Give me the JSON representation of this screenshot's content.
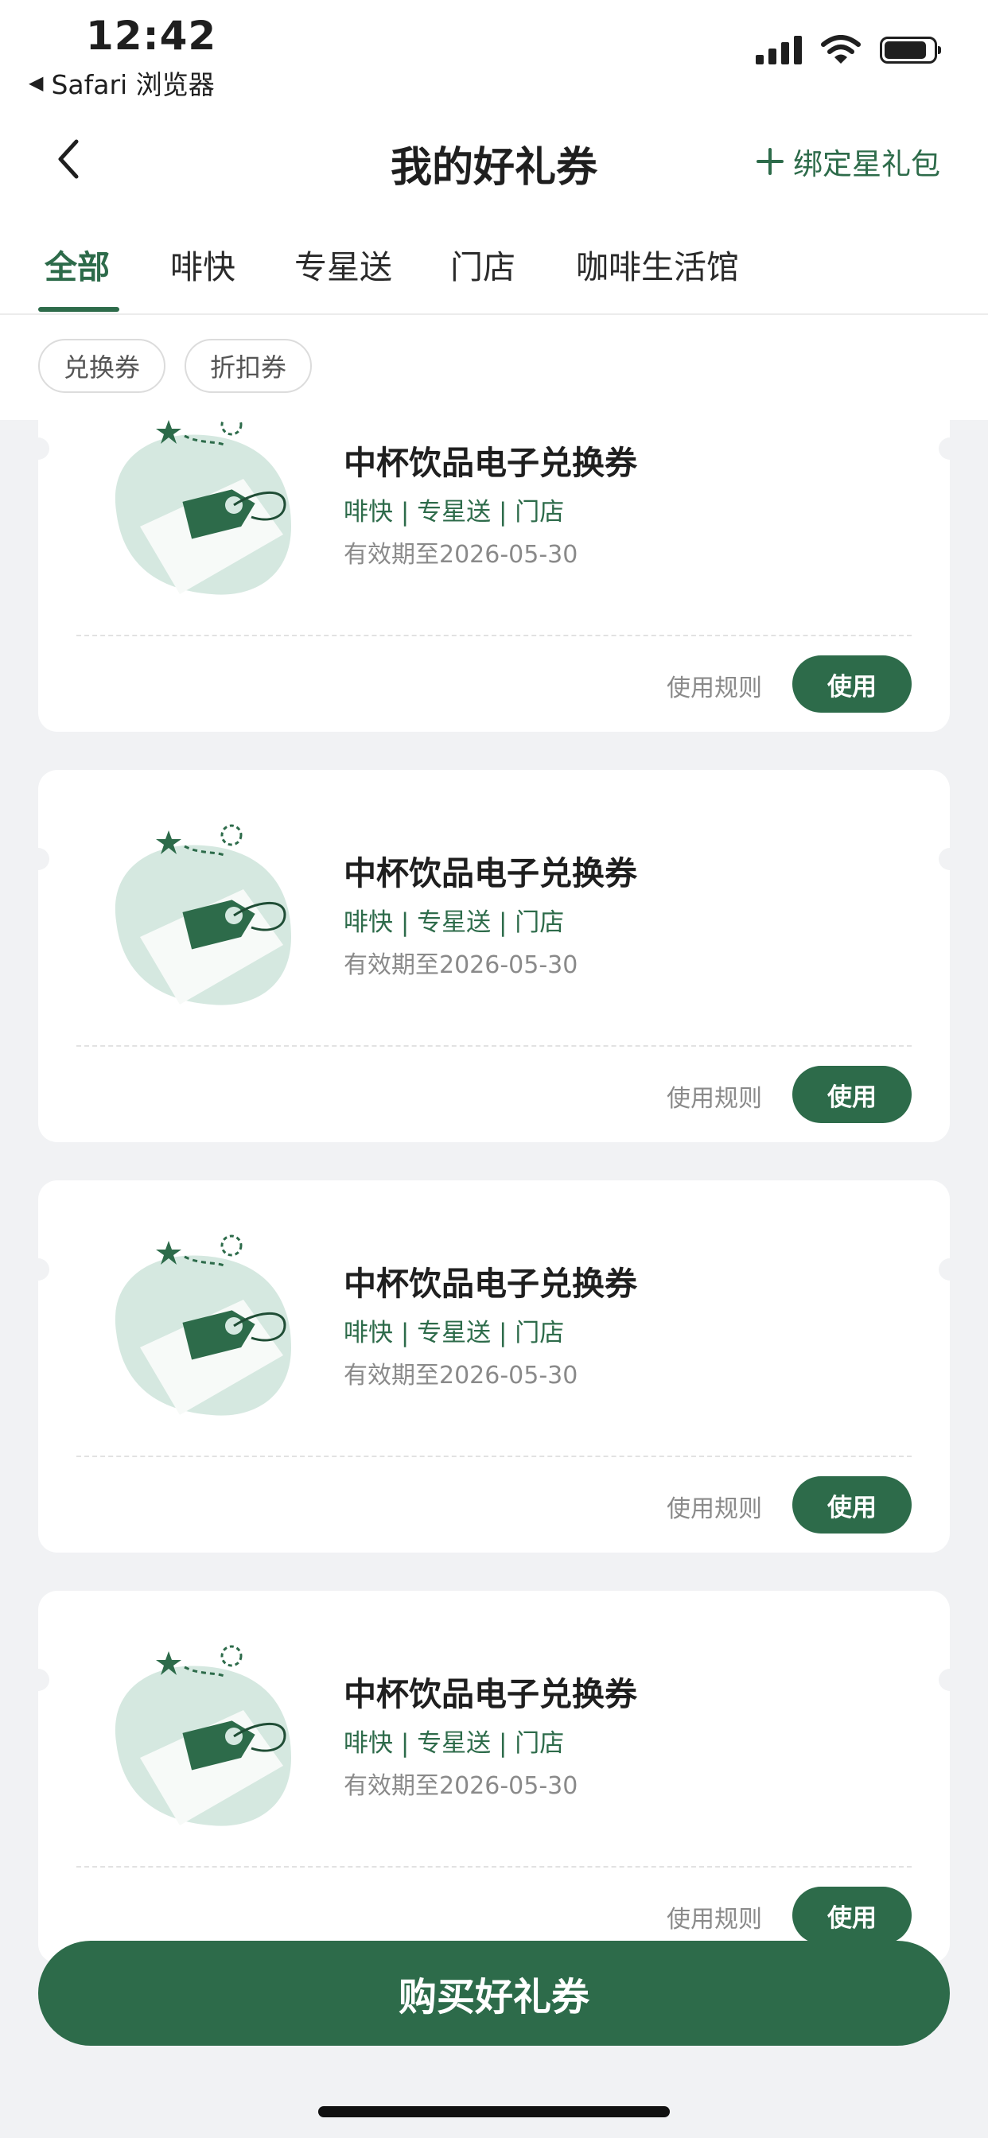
{
  "status_bar": {
    "time": "12:42",
    "back_app": "Safari 浏览器"
  },
  "nav": {
    "title": "我的好礼券",
    "bind_label": "绑定星礼包"
  },
  "tabs": [
    {
      "label": "全部",
      "active": true
    },
    {
      "label": "啡快"
    },
    {
      "label": "专星送"
    },
    {
      "label": "门店"
    },
    {
      "label": "咖啡生活馆"
    }
  ],
  "filters": [
    {
      "label": "兑换券"
    },
    {
      "label": "折扣券"
    }
  ],
  "coupons": [
    {
      "name": "中杯饮品电子兑换券",
      "channels": "啡快 | 专星送 | 门店",
      "expiry": "有效期至2026-05-30",
      "rules_label": "使用规则",
      "use_label": "使用"
    },
    {
      "name": "中杯饮品电子兑换券",
      "channels": "啡快 | 专星送 | 门店",
      "expiry": "有效期至2026-05-30",
      "rules_label": "使用规则",
      "use_label": "使用"
    },
    {
      "name": "中杯饮品电子兑换券",
      "channels": "啡快 | 专星送 | 门店",
      "expiry": "有效期至2026-05-30",
      "rules_label": "使用规则",
      "use_label": "使用"
    },
    {
      "name": "中杯饮品电子兑换券",
      "channels": "啡快 | 专星送 | 门店",
      "expiry": "有效期至2026-05-30",
      "rules_label": "使用规则",
      "use_label": "使用"
    }
  ],
  "buy_button": "购买好礼券",
  "colors": {
    "accent": "#2d6b4a",
    "background": "#f1f2f4",
    "tag_light": "#d5e8e0"
  },
  "icons": [
    "back-chevron-icon",
    "plus-icon",
    "signal-icon",
    "wifi-icon",
    "battery-icon",
    "gift-tag-icon"
  ]
}
